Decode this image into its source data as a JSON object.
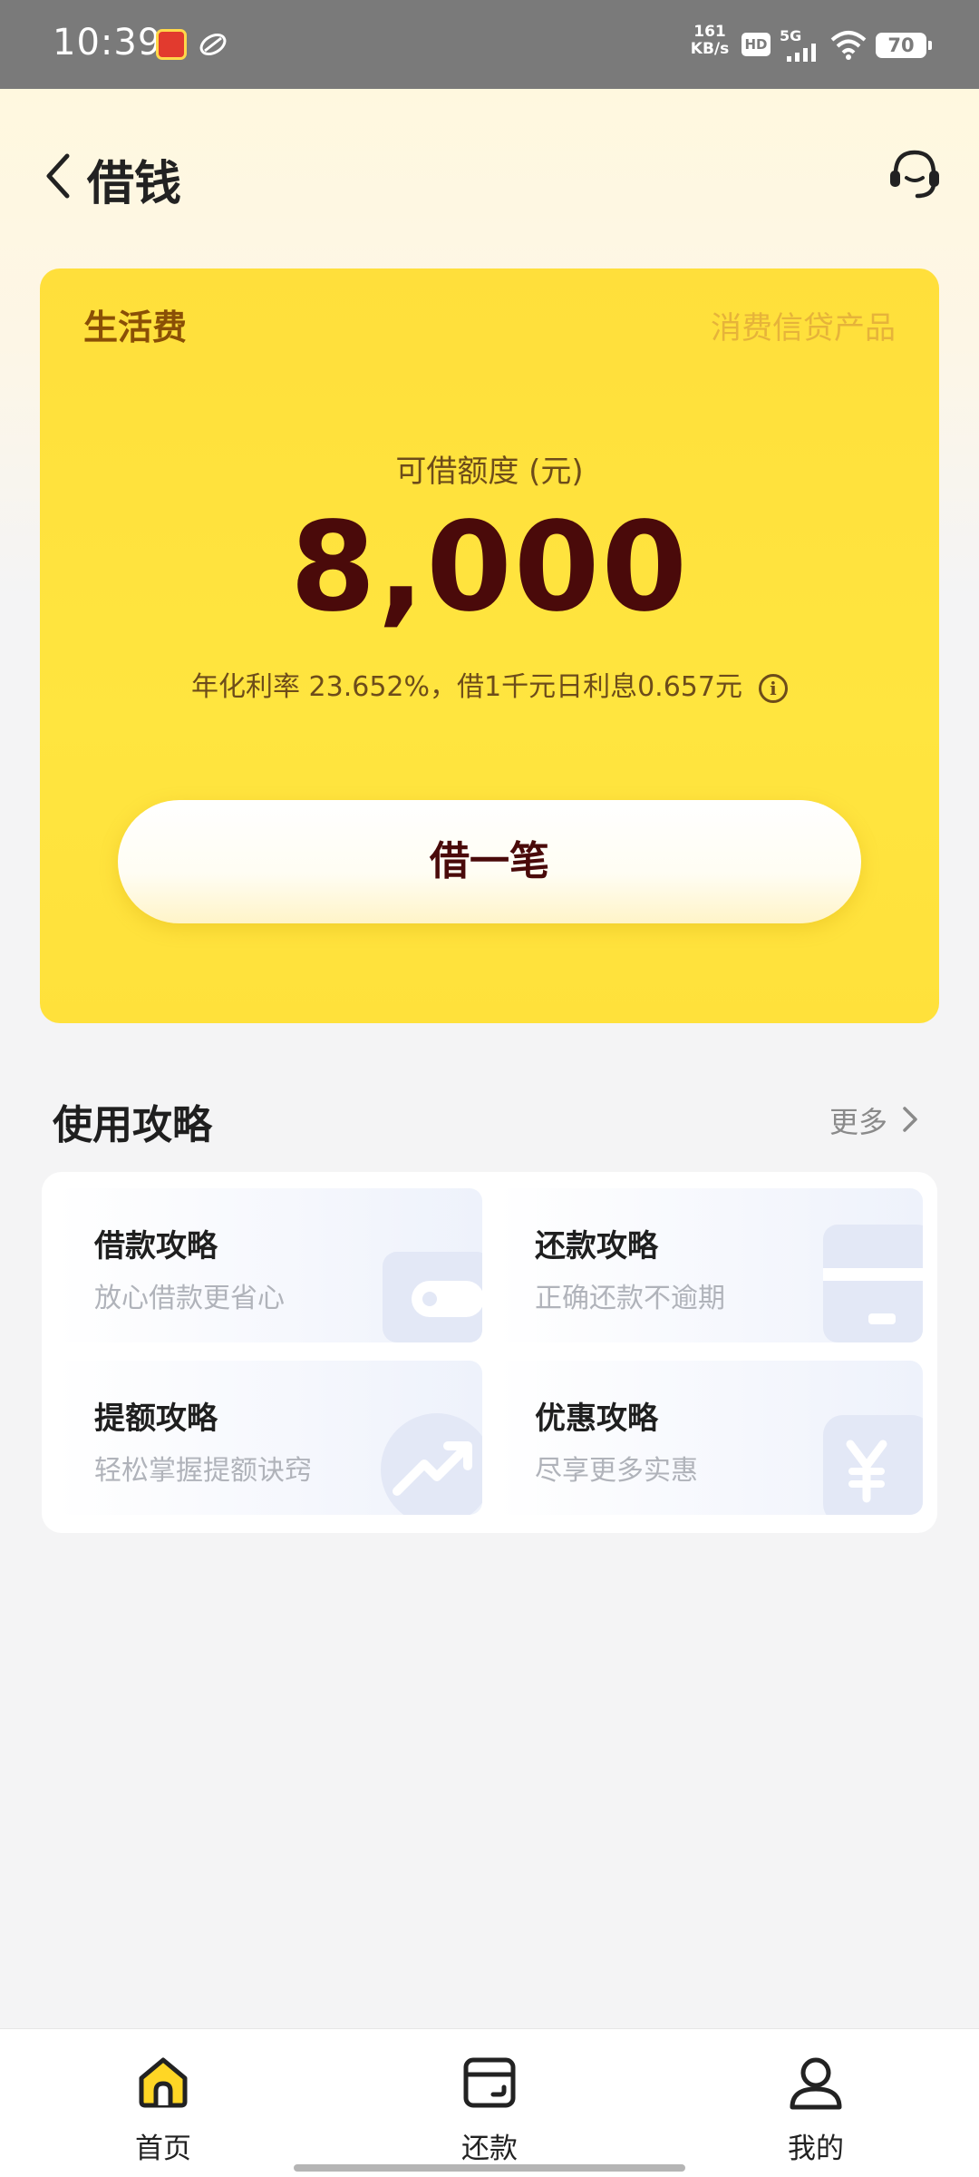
{
  "status_bar": {
    "time": "10:39",
    "net_speed_value": "161",
    "net_speed_unit": "KB/s",
    "hd": "HD",
    "network": "5G",
    "battery": "70"
  },
  "header": {
    "title": "借钱"
  },
  "loan_card": {
    "tag": "生活费",
    "subtag": "消费信贷产品",
    "limit_label": "可借额度 (元)",
    "limit_amount": "8,000",
    "rate_text": "年化利率 23.652%，借1千元日利息0.657元",
    "borrow_button": "借一笔"
  },
  "guide_section": {
    "title": "使用攻略",
    "more": "更多",
    "items": [
      {
        "title": "借款攻略",
        "desc": "放心借款更省心",
        "icon": "wallet-icon"
      },
      {
        "title": "还款攻略",
        "desc": "正确还款不逾期",
        "icon": "card-icon"
      },
      {
        "title": "提额攻略",
        "desc": "轻松掌握提额诀窍",
        "icon": "trend-up-icon"
      },
      {
        "title": "优惠攻略",
        "desc": "尽享更多实惠",
        "icon": "yen-icon"
      }
    ]
  },
  "bottom_nav": {
    "items": [
      {
        "label": "首页",
        "icon": "home-icon",
        "active": true
      },
      {
        "label": "还款",
        "icon": "repay-wallet-icon",
        "active": false
      },
      {
        "label": "我的",
        "icon": "profile-icon",
        "active": false
      }
    ]
  },
  "colors": {
    "card_yellow": "#ffe13b",
    "amount_text": "#4a0a0a",
    "tag_brown": "#8a4f06"
  }
}
